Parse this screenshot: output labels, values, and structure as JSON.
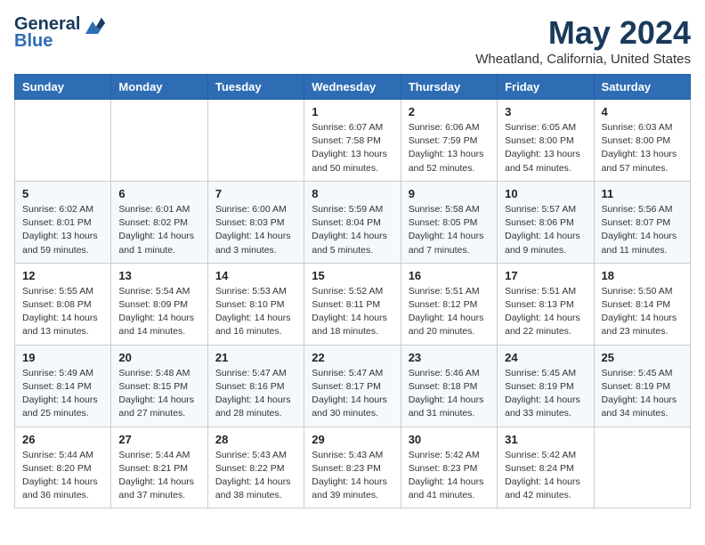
{
  "logo": {
    "line1": "General",
    "line2": "Blue"
  },
  "title": "May 2024",
  "subtitle": "Wheatland, California, United States",
  "weekdays": [
    "Sunday",
    "Monday",
    "Tuesday",
    "Wednesday",
    "Thursday",
    "Friday",
    "Saturday"
  ],
  "weeks": [
    [
      {
        "day": "",
        "sunrise": "",
        "sunset": "",
        "daylight": ""
      },
      {
        "day": "",
        "sunrise": "",
        "sunset": "",
        "daylight": ""
      },
      {
        "day": "",
        "sunrise": "",
        "sunset": "",
        "daylight": ""
      },
      {
        "day": "1",
        "sunrise": "Sunrise: 6:07 AM",
        "sunset": "Sunset: 7:58 PM",
        "daylight": "Daylight: 13 hours and 50 minutes."
      },
      {
        "day": "2",
        "sunrise": "Sunrise: 6:06 AM",
        "sunset": "Sunset: 7:59 PM",
        "daylight": "Daylight: 13 hours and 52 minutes."
      },
      {
        "day": "3",
        "sunrise": "Sunrise: 6:05 AM",
        "sunset": "Sunset: 8:00 PM",
        "daylight": "Daylight: 13 hours and 54 minutes."
      },
      {
        "day": "4",
        "sunrise": "Sunrise: 6:03 AM",
        "sunset": "Sunset: 8:00 PM",
        "daylight": "Daylight: 13 hours and 57 minutes."
      }
    ],
    [
      {
        "day": "5",
        "sunrise": "Sunrise: 6:02 AM",
        "sunset": "Sunset: 8:01 PM",
        "daylight": "Daylight: 13 hours and 59 minutes."
      },
      {
        "day": "6",
        "sunrise": "Sunrise: 6:01 AM",
        "sunset": "Sunset: 8:02 PM",
        "daylight": "Daylight: 14 hours and 1 minute."
      },
      {
        "day": "7",
        "sunrise": "Sunrise: 6:00 AM",
        "sunset": "Sunset: 8:03 PM",
        "daylight": "Daylight: 14 hours and 3 minutes."
      },
      {
        "day": "8",
        "sunrise": "Sunrise: 5:59 AM",
        "sunset": "Sunset: 8:04 PM",
        "daylight": "Daylight: 14 hours and 5 minutes."
      },
      {
        "day": "9",
        "sunrise": "Sunrise: 5:58 AM",
        "sunset": "Sunset: 8:05 PM",
        "daylight": "Daylight: 14 hours and 7 minutes."
      },
      {
        "day": "10",
        "sunrise": "Sunrise: 5:57 AM",
        "sunset": "Sunset: 8:06 PM",
        "daylight": "Daylight: 14 hours and 9 minutes."
      },
      {
        "day": "11",
        "sunrise": "Sunrise: 5:56 AM",
        "sunset": "Sunset: 8:07 PM",
        "daylight": "Daylight: 14 hours and 11 minutes."
      }
    ],
    [
      {
        "day": "12",
        "sunrise": "Sunrise: 5:55 AM",
        "sunset": "Sunset: 8:08 PM",
        "daylight": "Daylight: 14 hours and 13 minutes."
      },
      {
        "day": "13",
        "sunrise": "Sunrise: 5:54 AM",
        "sunset": "Sunset: 8:09 PM",
        "daylight": "Daylight: 14 hours and 14 minutes."
      },
      {
        "day": "14",
        "sunrise": "Sunrise: 5:53 AM",
        "sunset": "Sunset: 8:10 PM",
        "daylight": "Daylight: 14 hours and 16 minutes."
      },
      {
        "day": "15",
        "sunrise": "Sunrise: 5:52 AM",
        "sunset": "Sunset: 8:11 PM",
        "daylight": "Daylight: 14 hours and 18 minutes."
      },
      {
        "day": "16",
        "sunrise": "Sunrise: 5:51 AM",
        "sunset": "Sunset: 8:12 PM",
        "daylight": "Daylight: 14 hours and 20 minutes."
      },
      {
        "day": "17",
        "sunrise": "Sunrise: 5:51 AM",
        "sunset": "Sunset: 8:13 PM",
        "daylight": "Daylight: 14 hours and 22 minutes."
      },
      {
        "day": "18",
        "sunrise": "Sunrise: 5:50 AM",
        "sunset": "Sunset: 8:14 PM",
        "daylight": "Daylight: 14 hours and 23 minutes."
      }
    ],
    [
      {
        "day": "19",
        "sunrise": "Sunrise: 5:49 AM",
        "sunset": "Sunset: 8:14 PM",
        "daylight": "Daylight: 14 hours and 25 minutes."
      },
      {
        "day": "20",
        "sunrise": "Sunrise: 5:48 AM",
        "sunset": "Sunset: 8:15 PM",
        "daylight": "Daylight: 14 hours and 27 minutes."
      },
      {
        "day": "21",
        "sunrise": "Sunrise: 5:47 AM",
        "sunset": "Sunset: 8:16 PM",
        "daylight": "Daylight: 14 hours and 28 minutes."
      },
      {
        "day": "22",
        "sunrise": "Sunrise: 5:47 AM",
        "sunset": "Sunset: 8:17 PM",
        "daylight": "Daylight: 14 hours and 30 minutes."
      },
      {
        "day": "23",
        "sunrise": "Sunrise: 5:46 AM",
        "sunset": "Sunset: 8:18 PM",
        "daylight": "Daylight: 14 hours and 31 minutes."
      },
      {
        "day": "24",
        "sunrise": "Sunrise: 5:45 AM",
        "sunset": "Sunset: 8:19 PM",
        "daylight": "Daylight: 14 hours and 33 minutes."
      },
      {
        "day": "25",
        "sunrise": "Sunrise: 5:45 AM",
        "sunset": "Sunset: 8:19 PM",
        "daylight": "Daylight: 14 hours and 34 minutes."
      }
    ],
    [
      {
        "day": "26",
        "sunrise": "Sunrise: 5:44 AM",
        "sunset": "Sunset: 8:20 PM",
        "daylight": "Daylight: 14 hours and 36 minutes."
      },
      {
        "day": "27",
        "sunrise": "Sunrise: 5:44 AM",
        "sunset": "Sunset: 8:21 PM",
        "daylight": "Daylight: 14 hours and 37 minutes."
      },
      {
        "day": "28",
        "sunrise": "Sunrise: 5:43 AM",
        "sunset": "Sunset: 8:22 PM",
        "daylight": "Daylight: 14 hours and 38 minutes."
      },
      {
        "day": "29",
        "sunrise": "Sunrise: 5:43 AM",
        "sunset": "Sunset: 8:23 PM",
        "daylight": "Daylight: 14 hours and 39 minutes."
      },
      {
        "day": "30",
        "sunrise": "Sunrise: 5:42 AM",
        "sunset": "Sunset: 8:23 PM",
        "daylight": "Daylight: 14 hours and 41 minutes."
      },
      {
        "day": "31",
        "sunrise": "Sunrise: 5:42 AM",
        "sunset": "Sunset: 8:24 PM",
        "daylight": "Daylight: 14 hours and 42 minutes."
      },
      {
        "day": "",
        "sunrise": "",
        "sunset": "",
        "daylight": ""
      }
    ]
  ]
}
